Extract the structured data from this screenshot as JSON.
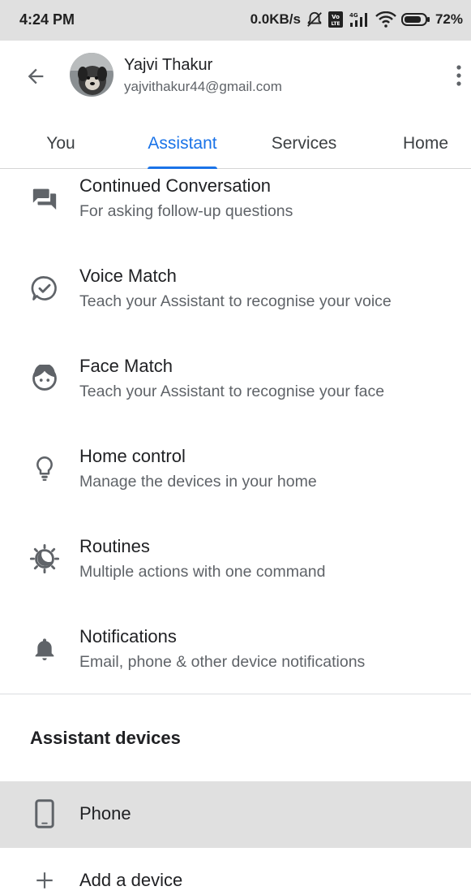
{
  "status_bar": {
    "time": "4:24 PM",
    "network_speed": "0.0KB/s",
    "battery": "72%"
  },
  "header": {
    "user_name": "Yajvi Thakur",
    "user_email": "yajvithakur44@gmail.com"
  },
  "tabs": [
    {
      "label": "You",
      "active": false
    },
    {
      "label": "Assistant",
      "active": true
    },
    {
      "label": "Services",
      "active": false
    },
    {
      "label": "Home",
      "active": false
    }
  ],
  "settings": [
    {
      "icon": "chat-bubbles-icon",
      "title": "Continued Conversation",
      "subtitle": "For asking follow-up questions"
    },
    {
      "icon": "voice-match-icon",
      "title": "Voice Match",
      "subtitle": "Teach your Assistant to recognise your voice"
    },
    {
      "icon": "face-icon",
      "title": "Face Match",
      "subtitle": "Teach your Assistant to recognise your face"
    },
    {
      "icon": "lightbulb-icon",
      "title": "Home control",
      "subtitle": "Manage the devices in your home"
    },
    {
      "icon": "routines-icon",
      "title": "Routines",
      "subtitle": "Multiple actions with one command"
    },
    {
      "icon": "bell-icon",
      "title": "Notifications",
      "subtitle": "Email, phone & other device notifications"
    }
  ],
  "assistant_devices": {
    "section_title": "Assistant devices",
    "devices": [
      {
        "icon": "phone-icon",
        "label": "Phone",
        "selected": true
      },
      {
        "icon": "plus-icon",
        "label": "Add a device",
        "selected": false
      }
    ]
  },
  "colors": {
    "accent": "#1a73e8",
    "status_bar_bg": "#e0e0e0",
    "selected_row_bg": "#e0e0e0",
    "primary_text": "#202124",
    "secondary_text": "#5f6368",
    "icon_gray": "#5f6368"
  }
}
